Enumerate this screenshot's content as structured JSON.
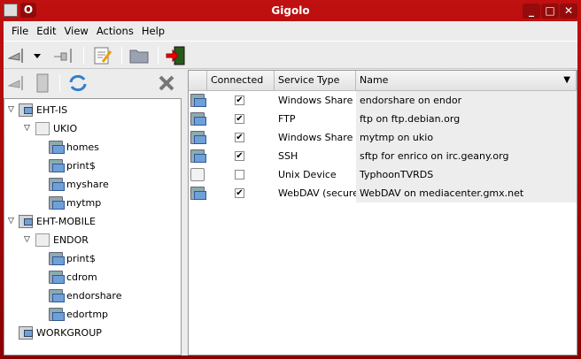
{
  "window": {
    "title": "Gigolo",
    "menu_button": "O",
    "controls": [
      "_",
      "□",
      "✕"
    ]
  },
  "menu": [
    "File",
    "Edit",
    "View",
    "Actions",
    "Help"
  ],
  "toolbar": [
    "connect-icon",
    "dropdown-arrow-icon",
    "disconnect-icon",
    "bookmarks-edit-icon",
    "open-folder-icon",
    "quit-icon"
  ],
  "side_toolbar": [
    "connect-icon",
    "bookmark-icon",
    "refresh-icon",
    "close-icon"
  ],
  "tree": [
    {
      "label": "EHT-IS",
      "level": 0,
      "type": "network",
      "expanded": true
    },
    {
      "label": "UKIO",
      "level": 1,
      "type": "server",
      "expanded": true
    },
    {
      "label": "homes",
      "level": 2,
      "type": "share"
    },
    {
      "label": "print$",
      "level": 2,
      "type": "share"
    },
    {
      "label": "myshare",
      "level": 2,
      "type": "share"
    },
    {
      "label": "mytmp",
      "level": 2,
      "type": "share"
    },
    {
      "label": "EHT-MOBILE",
      "level": 0,
      "type": "network",
      "expanded": true
    },
    {
      "label": "ENDOR",
      "level": 1,
      "type": "server",
      "expanded": true
    },
    {
      "label": "print$",
      "level": 2,
      "type": "share"
    },
    {
      "label": "cdrom",
      "level": 2,
      "type": "share"
    },
    {
      "label": "endorshare",
      "level": 2,
      "type": "share"
    },
    {
      "label": "edortmp",
      "level": 2,
      "type": "share"
    },
    {
      "label": "WORKGROUP",
      "level": 0,
      "type": "network"
    }
  ],
  "table": {
    "columns": [
      "",
      "Connected",
      "Service Type",
      "Name"
    ],
    "sort_indicator": "▼",
    "rows": [
      {
        "connected": true,
        "service": "Windows Share",
        "name": "endorshare on endor",
        "icon": "share"
      },
      {
        "connected": true,
        "service": "FTP",
        "name": "ftp on ftp.debian.org",
        "icon": "share"
      },
      {
        "connected": true,
        "service": "Windows Share",
        "name": "mytmp on ukio",
        "icon": "share"
      },
      {
        "connected": true,
        "service": "SSH",
        "name": "sftp for enrico on irc.geany.org",
        "icon": "share"
      },
      {
        "connected": false,
        "service": "Unix Device",
        "name": "TyphoonTVRDS",
        "icon": "drive"
      },
      {
        "connected": true,
        "service": "WebDAV (secure)",
        "name": "WebDAV on mediacenter.gmx.net",
        "icon": "share"
      }
    ]
  },
  "colors": {
    "titlebar": "#a80000",
    "selection": "#6fa0d8"
  }
}
